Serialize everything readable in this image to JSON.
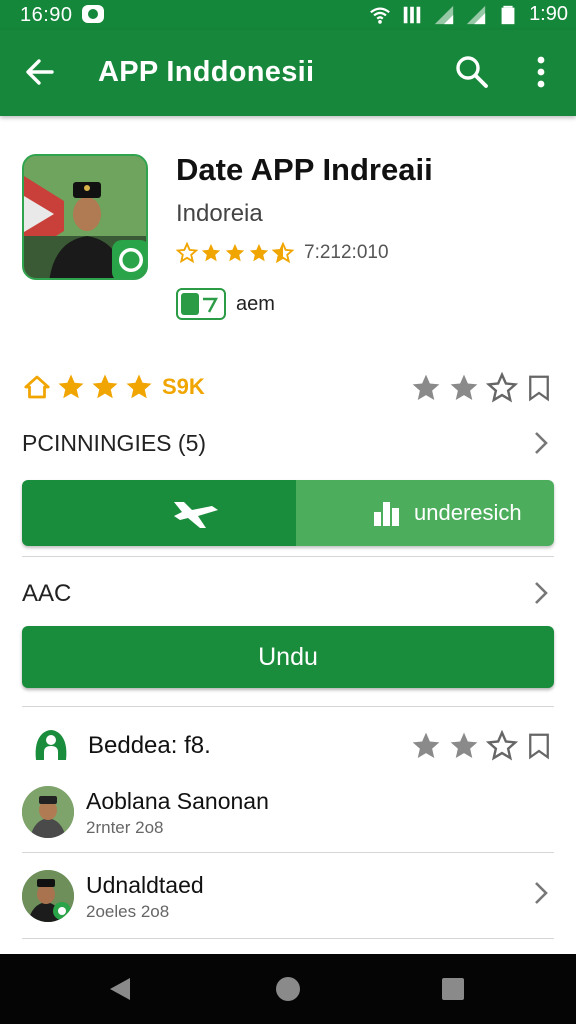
{
  "status_bar": {
    "time_left": "16:90",
    "time_right": "1:90",
    "icons": [
      "notification-icon",
      "wifi-icon",
      "signal-icon",
      "signal-icon",
      "battery-icon"
    ]
  },
  "app_bar": {
    "title": "APP Inddonesii",
    "icons": [
      "back-arrow-icon",
      "search-icon",
      "more-vert-icon"
    ]
  },
  "app": {
    "title": "Date APP Indreaii",
    "subtitle": "Indoreia",
    "rating_stars": 4.5,
    "rating_count": "7:212:010",
    "badge_label": "aem"
  },
  "rating_summary": {
    "stars": 3,
    "count": "S9K",
    "right_stars_filled": 2,
    "right_stars_total": 3
  },
  "section_pcn": {
    "label": "PCINNINGIES (5)"
  },
  "segmented": {
    "right_label": "underesich"
  },
  "section_aac": {
    "label": "AAC"
  },
  "download_button": {
    "label": "Undu"
  },
  "reviews": {
    "title": "Beddea: f8.",
    "items": [
      {
        "name": "Aoblana Sanonan",
        "meta": "2rnter 2o8"
      },
      {
        "name": "Udnaldtaed",
        "meta": "2oeles 2o8"
      }
    ]
  },
  "colors": {
    "primary": "#17883b",
    "primary_light": "#4cae5c",
    "star": "#f0a500",
    "star_gray": "#8a8a8a"
  }
}
